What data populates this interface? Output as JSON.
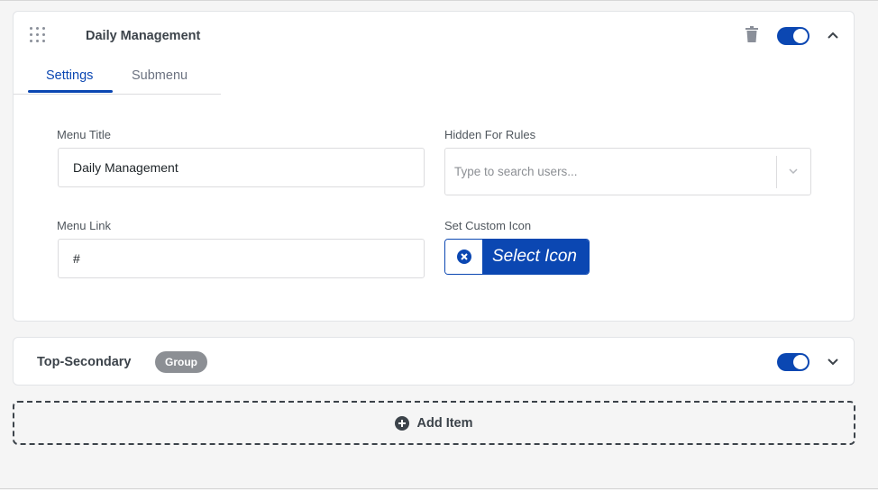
{
  "menu_item": {
    "title": "Daily Management",
    "enabled": true,
    "tabs": [
      {
        "label": "Settings",
        "active": true
      },
      {
        "label": "Submenu",
        "active": false
      }
    ],
    "fields": {
      "menu_title_label": "Menu Title",
      "menu_title_value": "Daily Management",
      "menu_link_label": "Menu Link",
      "menu_link_value": "#",
      "hidden_rules_label": "Hidden For Rules",
      "hidden_rules_placeholder": "Type to search users...",
      "custom_icon_label": "Set Custom Icon",
      "select_icon_label": "Select Icon"
    },
    "icons": {
      "drag": "drag-handle-icon",
      "delete": "trash-icon",
      "collapse": "chevron-up-icon",
      "clear_icon": "close-circle-icon"
    }
  },
  "group_item": {
    "title": "Top-Secondary",
    "badge": "Group",
    "enabled": true,
    "icons": {
      "expand": "chevron-down-icon"
    }
  },
  "add_item": {
    "label": "Add Item",
    "icon": "plus-circle-icon"
  },
  "colors": {
    "accent": "#0b47b2",
    "badge": "#8c8f94",
    "text": "#3c434a"
  }
}
